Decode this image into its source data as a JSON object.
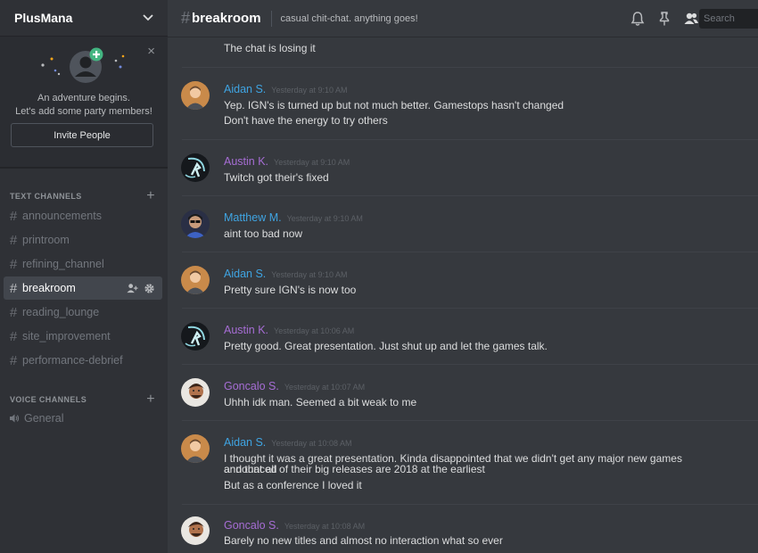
{
  "guild": {
    "name": "PlusMana"
  },
  "invite": {
    "line1": "An adventure begins.",
    "line2": "Let's add some party members!",
    "button": "Invite People",
    "close": "×"
  },
  "categories": {
    "text": "TEXT CHANNELS",
    "voice": "VOICE CHANNELS"
  },
  "text_channels": [
    {
      "name": "announcements"
    },
    {
      "name": "printroom"
    },
    {
      "name": "refining_channel"
    },
    {
      "name": "breakroom",
      "active": true
    },
    {
      "name": "reading_lounge"
    },
    {
      "name": "site_improvement"
    },
    {
      "name": "performance-debrief"
    }
  ],
  "voice_channels": [
    {
      "name": "General"
    }
  ],
  "channel": {
    "name": "breakroom",
    "topic": "casual chit-chat. anything goes!"
  },
  "search": {
    "placeholder": "Search"
  },
  "messages": {
    "orphan": "The chat is losing it",
    "groups": [
      {
        "author": "Aidan S.",
        "time": "Yesterday at 9:10 AM",
        "lines": [
          "Yep. IGN's is turned up but not much better. Gamestops hasn't changed",
          "Don't have the energy to try others"
        ]
      },
      {
        "author": "Austin K.",
        "time": "Yesterday at 9:10 AM",
        "lines": [
          "Twitch got their's fixed"
        ]
      },
      {
        "author": "Matthew M.",
        "time": "Yesterday at 9:10 AM",
        "lines": [
          "aint too bad now"
        ]
      },
      {
        "author": "Aidan S.",
        "time": "Yesterday at 9:10 AM",
        "lines": [
          "Pretty sure IGN's is now too"
        ]
      },
      {
        "author": "Austin K.",
        "time": "Yesterday at 10:06 AM",
        "lines": [
          "Pretty good. Great presentation. Just shut up and let the games talk."
        ]
      },
      {
        "author": "Goncalo S.",
        "time": "Yesterday at 10:07 AM",
        "lines": [
          "Uhhh idk man. Seemed a bit weak to me"
        ]
      },
      {
        "author": "Aidan S.",
        "time": "Yesterday at 10:08 AM",
        "lines": [
          "I thought it was a great presentation. Kinda disappointed that we didn't get any major new games announced",
          "and that all of their big releases are 2018 at the earliest",
          "But as a conference I loved it"
        ]
      },
      {
        "author": "Goncalo S.",
        "time": "Yesterday at 10:08 AM",
        "lines": [
          "Barely no new titles and almost no interaction what so ever"
        ]
      }
    ]
  },
  "colors": {
    "sidebar": "#2f3136",
    "chat": "#36393e",
    "blue_author": "#3fa4e2",
    "purple_author": "#a66dd4",
    "invite_plus": "#43b581"
  }
}
